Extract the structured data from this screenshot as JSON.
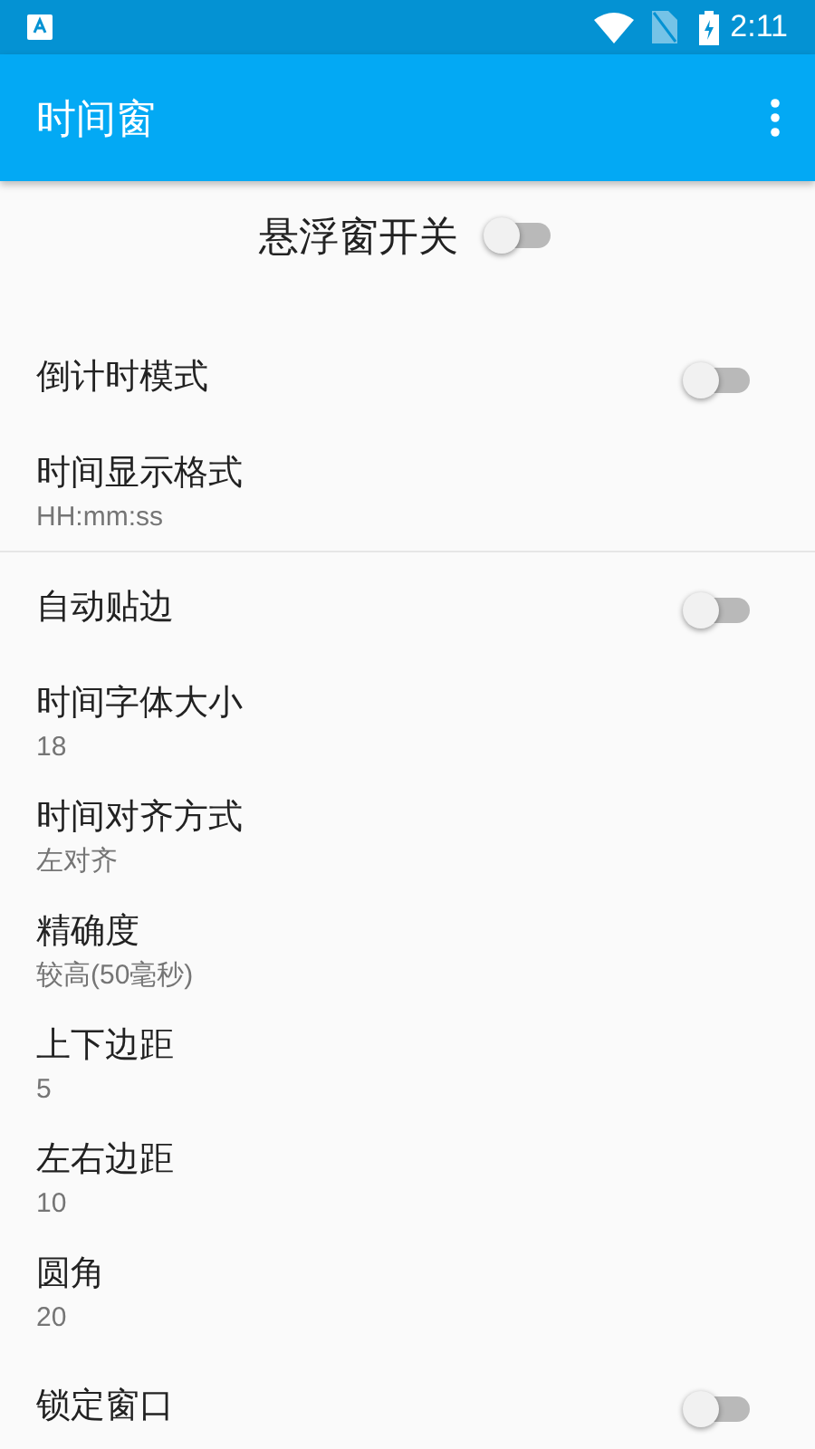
{
  "status_bar": {
    "time": "2:11"
  },
  "app_bar": {
    "title": "时间窗"
  },
  "master_switch": {
    "label": "悬浮窗开关",
    "on": false
  },
  "sections": [
    {
      "items": [
        {
          "kind": "switch",
          "title": "倒计时模式",
          "on": false
        },
        {
          "kind": "value",
          "title": "时间显示格式",
          "summary": "HH:mm:ss"
        }
      ]
    },
    {
      "items": [
        {
          "kind": "switch",
          "title": "自动贴边",
          "on": false
        },
        {
          "kind": "value",
          "title": "时间字体大小",
          "summary": "18"
        },
        {
          "kind": "value",
          "title": "时间对齐方式",
          "summary": "左对齐"
        },
        {
          "kind": "value",
          "title": "精确度",
          "summary": "较高(50毫秒)"
        },
        {
          "kind": "value",
          "title": "上下边距",
          "summary": "5"
        },
        {
          "kind": "value",
          "title": "左右边距",
          "summary": "10"
        },
        {
          "kind": "value",
          "title": "圆角",
          "summary": "20"
        },
        {
          "kind": "switch",
          "title": "锁定窗口",
          "on": false
        }
      ]
    }
  ]
}
